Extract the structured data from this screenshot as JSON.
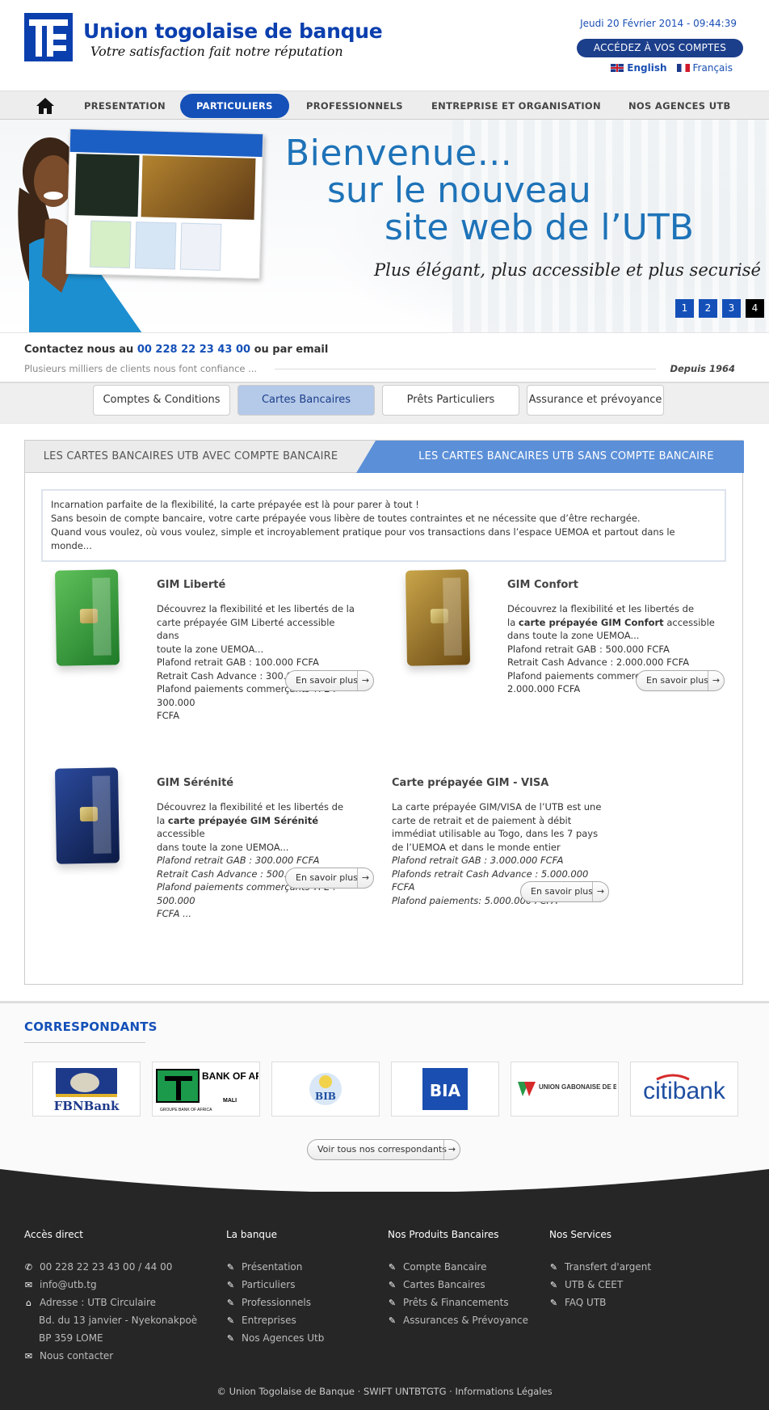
{
  "header": {
    "brand_name": "Union togolaise de banque",
    "tagline": "Votre satisfaction fait notre réputation",
    "date": "Jeudi 20 Février 2014 - 09:44:39",
    "access_button": "ACCÉDEZ À VOS COMPTES",
    "lang_en": "English",
    "lang_fr": "Français"
  },
  "nav": {
    "items": [
      "PRESENTATION",
      "PARTICULIERS",
      "PROFESSIONNELS",
      "ENTREPRISE ET ORGANISATION",
      "NOS AGENCES UTB"
    ],
    "active": "PARTICULIERS"
  },
  "banner": {
    "line1": "Bienvenue...",
    "line2": "sur le nouveau",
    "line3": "site web de l’UTB",
    "subtitle": "Plus élégant, plus accessible et plus securisé",
    "pages": [
      "1",
      "2",
      "3",
      "4"
    ],
    "active_page": "4"
  },
  "contact": {
    "prefix": "Contactez nous au ",
    "phone": "00 228 22 23 43 00",
    "suffix": " ou par email",
    "sub": "Plusieurs milliers de clients nous font confiance ...",
    "since": "Depuis 1964"
  },
  "subtabs": [
    "Comptes & Conditions",
    "Cartes Bancaires",
    "Prêts Particuliers",
    "Assurance et prévoyance"
  ],
  "panel": {
    "tab_a": "LES CARTES BANCAIRES UTB AVEC COMPTE BANCAIRE",
    "tab_b": "LES CARTES BANCAIRES UTB SANS COMPTE BANCAIRE",
    "intro1": "Incarnation parfaite de la flexibilité, la carte prépayée est là pour parer à tout !",
    "intro2": "Sans besoin de compte bancaire, votre carte prépayée vous libère de toutes contraintes et ne nécessite que d’être rechargée.",
    "intro3": "Quand vous voulez, où vous voulez, simple et incroyablement pratique pour vos transactions dans l’espace  UEMOA et partout dans le monde...",
    "cards": [
      {
        "title": "GIM Liberté",
        "lines": [
          "Découvrez la flexibilité et les libertés de la",
          "carte prépayée GIM Liberté accessible dans",
          "toute la zone UEMOA...",
          "Plafond retrait GAB : 100.000 FCFA",
          "Retrait Cash Advance : 300.000 FCFA",
          "Plafond paiements commerçants TPE : 300.000",
          "FCFA"
        ],
        "color": "#2f9a3a"
      },
      {
        "title": "GIM Confort",
        "lines": [
          "Découvrez la flexibilité et les libertés de",
          "la ",
          "carte prépayée GIM Confort",
          " accessible",
          "dans toute la zone UEMOA...",
          "Plafond retrait GAB : 500.000 FCFA",
          "Retrait Cash Advance : 2.000.000 FCFA",
          "Plafond paiements commerçants TPE :",
          "2.000.000 FCFA"
        ],
        "color": "#9c7a2a"
      },
      {
        "title": "GIM Sérénité",
        "lines": [
          "Découvrez la flexibilité et les libertés de",
          "la ",
          "carte prépayée GIM Sérénité",
          " accessible",
          "dans toute la zone UEMOA...",
          "Plafond retrait GAB : 300.000 FCFA",
          "Retrait Cash Advance : 500.000 FCFA",
          "Plafond paiements commerçants TPE : 500.000",
          "FCFA ..."
        ],
        "color": "#1b2f6a"
      },
      {
        "title": "Carte prépayée GIM - VISA",
        "lines": [
          "La carte prépayée GIM/VISA de l’UTB est une",
          "carte de retrait et de paiement à débit",
          "immédiat utilisable au Togo, dans les 7 pays",
          "de l’UEMOA et dans le monde entier",
          "Plafond retrait GAB : 3.000.000 FCFA",
          "Plafonds retrait Cash Advance : 5.000.000",
          "FCFA",
          "Plafond paiements: 5.000.000 FCFA"
        ]
      }
    ],
    "more_label": "En savoir plus",
    "arrow": "→"
  },
  "corr": {
    "title": "CORRESPONDANTS",
    "logos": [
      "FBNBank",
      "BANK OF AFRICA",
      "MALI",
      "GROUPE BANK OF AFRICA",
      "BIB",
      "BIA",
      "UNION GABONAISE DE BANQUE",
      "citibank"
    ],
    "voir": "Voir tous nos correspondants"
  },
  "footer": {
    "col1": {
      "title": "Accès direct",
      "phone": "00 228 22 23 43 00 / 44 00",
      "email": "info@utb.tg",
      "addr1": "Adresse : UTB Circulaire",
      "addr2": "Bd. du 13 janvier - Nyekonakpoè",
      "addr3": "BP 359 LOME",
      "contact": "Nous contacter"
    },
    "col2": {
      "title": "La banque",
      "items": [
        "Présentation",
        "Particuliers",
        "Professionnels",
        "Entreprises",
        "Nos Agences Utb"
      ]
    },
    "col3": {
      "title": "Nos Produits Bancaires",
      "items": [
        "Compte Bancaire",
        "Cartes Bancaires",
        "Prêts & Financements",
        "Assurances & Prévoyance"
      ]
    },
    "col4": {
      "title": "Nos Services",
      "items": [
        "Transfert d'argent",
        "UTB & CEET",
        "FAQ UTB"
      ]
    },
    "copyright": "© Union Togolaise de Banque · SWIFT UNTBTGTG · Informations Légales"
  },
  "colors": {
    "brand_blue": "#0b3fae",
    "nav_active": "#1450b8",
    "footer_bg": "#262626",
    "tab_blue": "#5b8fd8"
  }
}
